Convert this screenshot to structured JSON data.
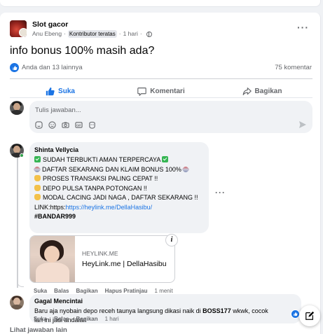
{
  "post": {
    "group_name": "Slot gacor",
    "author": "Anu Ebeng",
    "badge": "Kontributor teratas",
    "time": "1 hari",
    "text": "info bonus 100% masih ada?",
    "reactions_text": "Anda dan 13 lainnya",
    "comment_count": "75 komentar"
  },
  "actions": {
    "like": "Suka",
    "comment": "Komentari",
    "share": "Bagikan"
  },
  "compose": {
    "placeholder": "Tulis jawaban..."
  },
  "comments": [
    {
      "author": "Shinta Vellycia",
      "lines": [
        "SUDAH TERBUKTI AMAN TERPERCAYA",
        "DAFTAR SEKARANG DAN KLAIM BONUS 100%",
        "PROSES TRANSAKSI PALING CEPAT !!",
        "DEPO PULSA TANPA POTONGAN !!",
        "MODAL CACING JADI NAGA , DAFTAR SEKARANG !!"
      ],
      "link_prefix": "LINK:https:",
      "link": "https://heylink.me/DellaHasibu/",
      "hashtag": "#BANDAR999",
      "preview": {
        "domain": "HEYLINK.ME",
        "title": "HeyLink.me | DellaHasibu"
      },
      "actions": [
        "Suka",
        "Balas",
        "Bagikan",
        "Hapus Pratinjau",
        "1 menit"
      ]
    },
    {
      "author": "Gagal Mencintai",
      "text_before": "Baru aja nyobain depo receh taunya langsung dikasi naik di ",
      "text_bold": "BOSS177",
      "text_after": " wkwk, cocok",
      "text_line2": "lah ini jadi andalan",
      "actions": [
        "Suka",
        "Balas",
        "Bagikan",
        "1 hari"
      ]
    }
  ],
  "more_replies": "Lihat jawaban lain",
  "colors": {
    "accent": "#1b74e4",
    "secondary_text": "#65676b",
    "bubble": "#f0f2f5"
  }
}
